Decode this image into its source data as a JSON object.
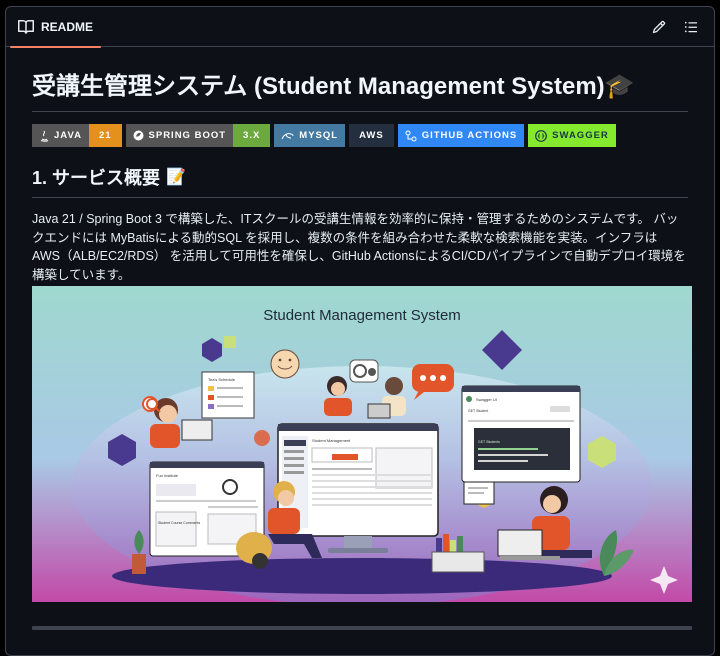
{
  "tab": {
    "label": "README",
    "icon": "book-icon"
  },
  "actions": {
    "edit_icon": "pencil-icon",
    "outline_icon": "list-icon"
  },
  "title": "受講生管理システム (Student Management System)🎓",
  "badges": [
    {
      "label": "JAVA",
      "value": "21",
      "label_color": "#555555",
      "value_color": "#e4901d",
      "icon": "java-icon"
    },
    {
      "label": "SPRING BOOT",
      "value": "3.X",
      "label_color": "#555555",
      "value_color": "#6ca93f",
      "icon": "spring-icon"
    },
    {
      "label": "MYSQL",
      "value": "",
      "label_color": "#4479a1",
      "value_color": "",
      "icon": "mysql-icon"
    },
    {
      "label": "AWS",
      "value": "",
      "label_color": "#232f3e",
      "value_color": "",
      "icon": ""
    },
    {
      "label": "GITHUB ACTIONS",
      "value": "",
      "label_color": "#2f88f6",
      "value_color": "",
      "icon": "github-actions-icon"
    },
    {
      "label": "SWAGGER",
      "value": "",
      "label_color": "#85ea2d",
      "value_color": "",
      "icon": "swagger-icon"
    }
  ],
  "section1": {
    "heading": "1. サービス概要",
    "emoji": "📝",
    "text": "Java 21 / Spring Boot 3 で構築した、ITスクールの受講生情報を効率的に保持・管理するためのシステムです。 バックエンドには MyBatisによる動的SQL を採用し、複数の条件を組み合わせた柔軟な検索機能を実装。インフラは AWS（ALB/EC2/RDS） を活用して可用性を確保し、GitHub ActionsによるCI/CDパイプラインで自動デプロイ環境を構築しています。"
  },
  "hero": {
    "title": "Student Management System",
    "laptop_title": "Fun Institute",
    "monitor_title": "Student Management",
    "swagger_title": "Swagger UI",
    "swagger_subtitle": "GET Student",
    "swagger_endpoint": "GET Students",
    "board_title": "Tea's Schedule",
    "form_title": "Student Course Comments",
    "colors": {
      "bg_top": "#9fd8ce",
      "bg_bottom": "#c24aa8",
      "accent": "#5b3f8f",
      "chat": "#e2552a"
    }
  }
}
